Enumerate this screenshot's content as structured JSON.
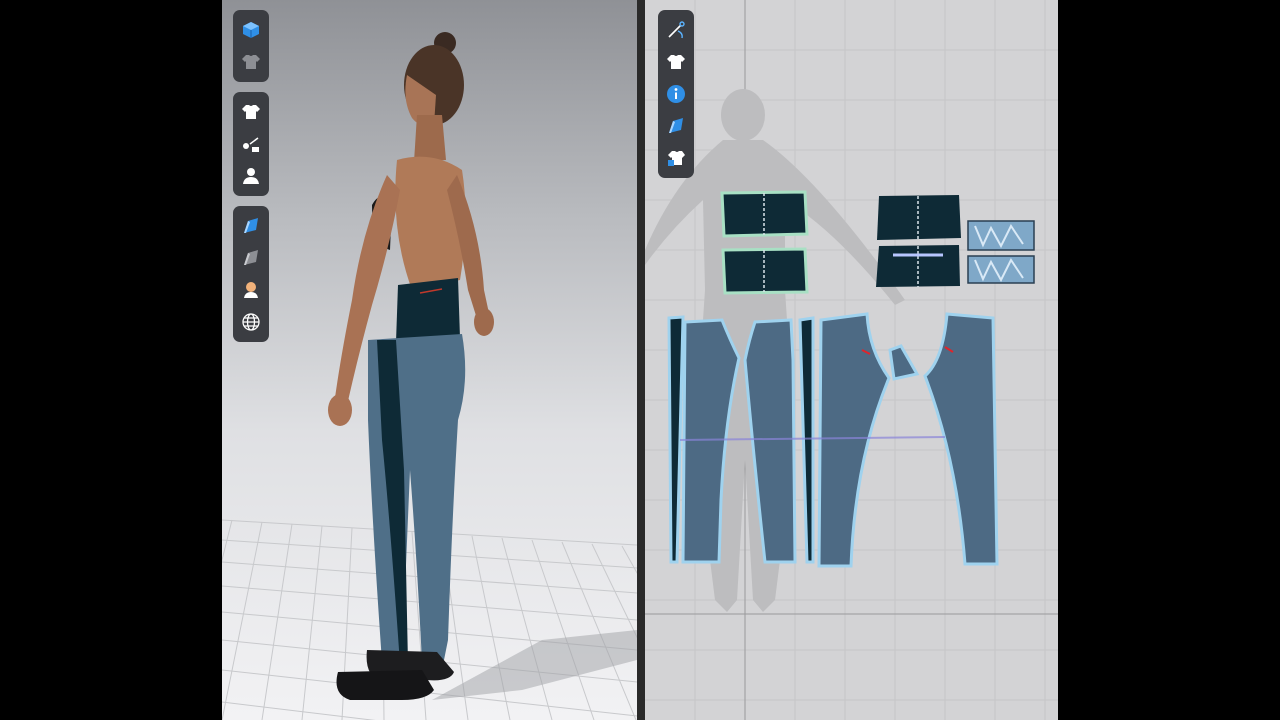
{
  "app": {
    "left_panel": "3d-avatar-view",
    "right_panel": "2d-pattern-view"
  },
  "toolbar_3d": {
    "groups": [
      [
        "display-3d-icon",
        "garment-texture-icon"
      ],
      [
        "garment-icon",
        "sewing-icon",
        "avatar-icon"
      ],
      [
        "fabric-icon",
        "shadow-icon",
        "skin-icon",
        "environment-icon"
      ]
    ]
  },
  "toolbar_2d": {
    "items": [
      "edit-needle-icon",
      "garment-icon",
      "info-icon",
      "fabric-icon",
      "garment-lock-icon"
    ]
  },
  "colors": {
    "panel_dark": "#0e2a36",
    "panel_pattern": "#4d6a84",
    "outline_selected": "#9fd2ee",
    "toolbar_bg": "#3b3d42",
    "skin": "#b07a58"
  }
}
